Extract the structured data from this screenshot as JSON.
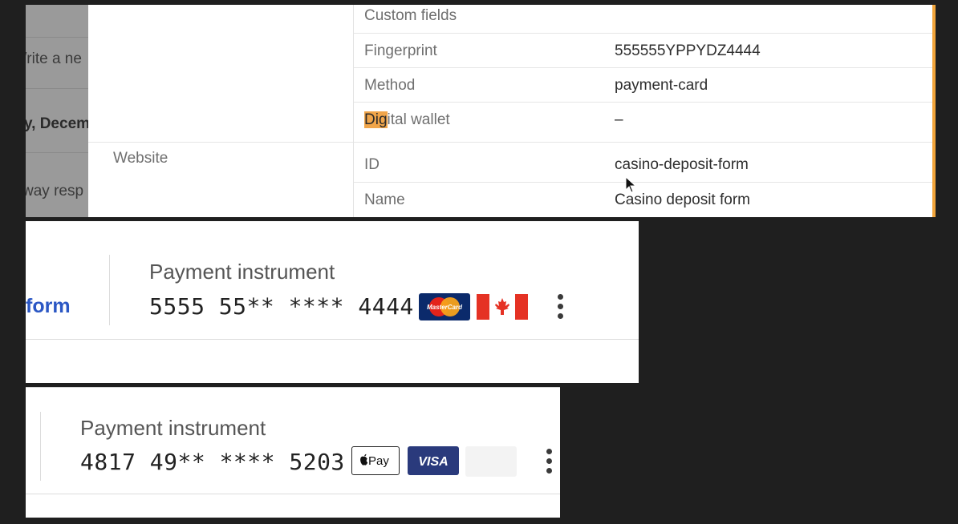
{
  "left_strip": {
    "fragments": [
      "/rite a ne",
      "y, Decem",
      "way resp"
    ]
  },
  "details": {
    "section_label": "Website",
    "rows": [
      {
        "key": "Custom fields",
        "value": ""
      },
      {
        "key": "Fingerprint",
        "value": "555555YPPYDZ4444"
      },
      {
        "key": "Method",
        "value": "payment-card"
      },
      {
        "key_highlight": "Dig",
        "key_rest": "ital wallet",
        "value": "–"
      },
      {
        "key": "ID",
        "value": "casino-deposit-form"
      },
      {
        "key": "Name",
        "value": "Casino deposit form"
      }
    ]
  },
  "card_one": {
    "link_fragment": "form",
    "label": "Payment instrument",
    "number": "5555 55** **** 4444",
    "brand": "MasterCard",
    "brand_icon": "mastercard-icon",
    "country_icon": "canada-flag-icon",
    "menu_icon": "kebab-menu-icon"
  },
  "card_two": {
    "label": "Payment instrument",
    "number": "4817 49** **** 5203",
    "wallet": "Pay",
    "wallet_icon": "apple-pay-icon",
    "brand": "VISA",
    "brand_icon": "visa-icon",
    "menu_icon": "kebab-menu-icon"
  },
  "colors": {
    "background": "#1f1f1f",
    "accent": "#f2a53b",
    "link": "#2b57c4",
    "visa": "#2a3a7c",
    "mastercard_bg": "#0b2a6b",
    "canada_red": "#e53224"
  }
}
